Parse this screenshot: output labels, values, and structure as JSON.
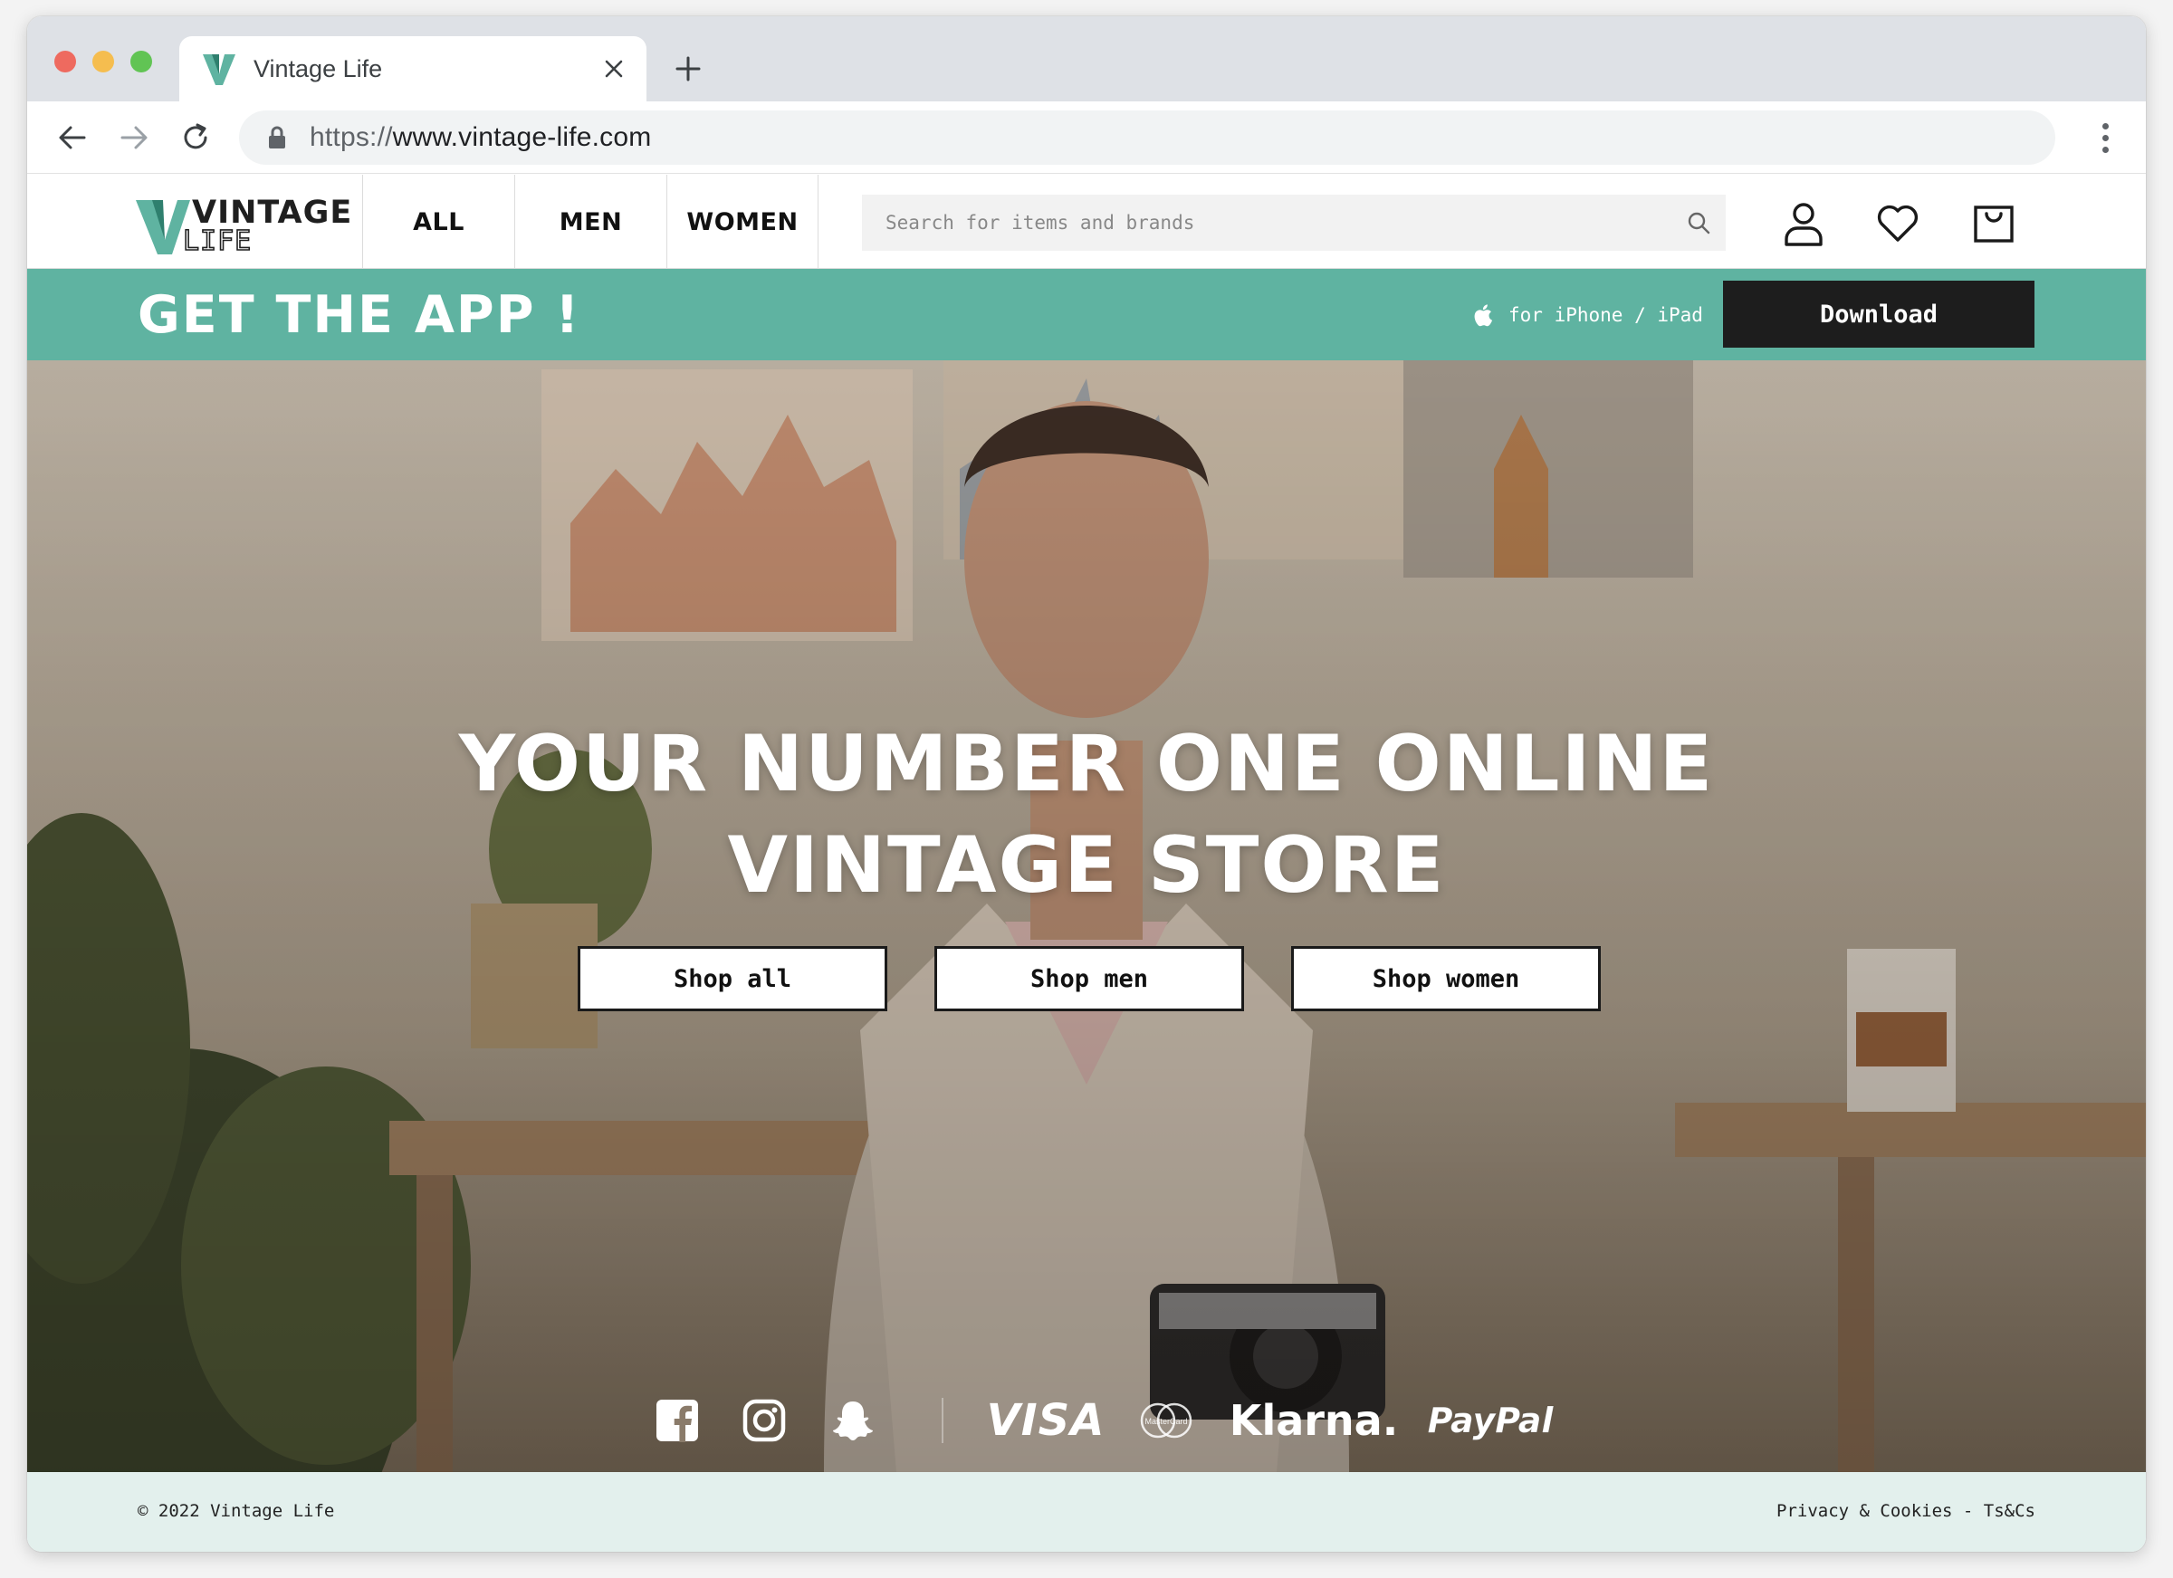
{
  "browser": {
    "tab_title": "Vintage Life",
    "url_scheme": "https://",
    "url_rest": "www.vintage-life.com"
  },
  "header": {
    "logo_top": "VINTAGE",
    "logo_bottom": "LIFE",
    "nav": [
      {
        "label": "ALL"
      },
      {
        "label": "MEN"
      },
      {
        "label": "WOMEN"
      }
    ],
    "search_placeholder": "Search for items and brands",
    "icons": [
      "user-icon",
      "heart-icon",
      "shopping-bag-icon"
    ]
  },
  "app_banner": {
    "title": "GET THE APP !",
    "platform": "for iPhone / iPad",
    "button": "Download"
  },
  "hero": {
    "title_line1": "YOUR NUMBER ONE ONLINE",
    "title_line2": "VINTAGE STORE",
    "ctas": [
      {
        "label": "Shop all"
      },
      {
        "label": "Shop men"
      },
      {
        "label": "Shop women"
      }
    ]
  },
  "payments": {
    "visa": "VISA",
    "mastercard": "MasterCard",
    "klarna": "Klarna.",
    "paypal": "PayPal"
  },
  "footer": {
    "copyright": "© 2022 Vintage Life",
    "legal": "Privacy & Cookies - Ts&Cs"
  },
  "colors": {
    "accent": "#5fb3a1",
    "footer_bg": "#e3f0ed",
    "button_dark": "#1d1d1d"
  }
}
